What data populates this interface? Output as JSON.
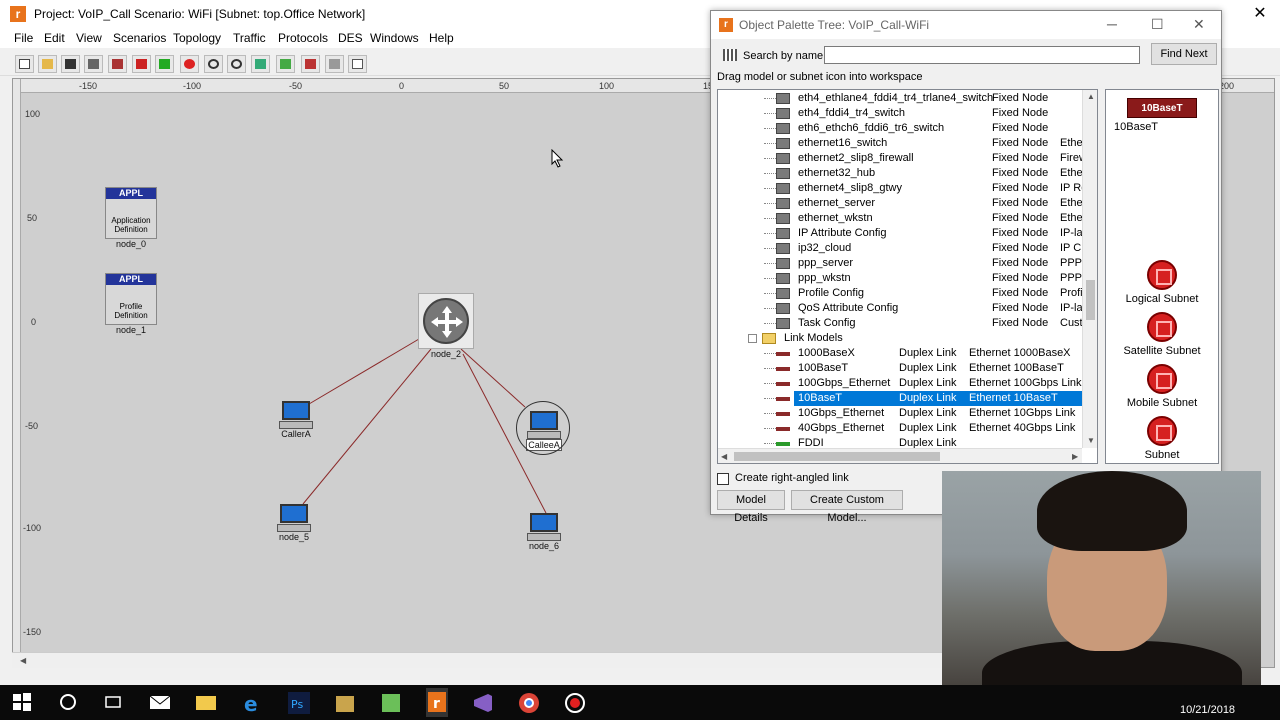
{
  "window": {
    "title": "Project: VoIP_Call Scenario: WiFi  [Subnet: top.Office Network]",
    "app_icon_letter": "r",
    "close_glyph": "✕"
  },
  "menu": [
    "File",
    "Edit",
    "View",
    "Scenarios",
    "Topology",
    "Traffic",
    "Protocols",
    "DES",
    "Windows",
    "Help"
  ],
  "toolbar_icons": [
    "new-icon",
    "open-icon",
    "save-icon",
    "print-icon",
    "node-config-icon",
    "failure-icon",
    "recover-icon",
    "annotation-icon",
    "zoom-in-icon",
    "zoom-out-icon",
    "ace-icon",
    "simulate-icon",
    "results-icon",
    "edit-attributes-icon",
    "graph-icon"
  ],
  "ruler": {
    "x_labels": [
      "-150",
      "-100",
      "-50",
      "0",
      "50",
      "100",
      "150",
      "200"
    ],
    "y_labels": [
      "100",
      "50",
      "0",
      "-50",
      "-100",
      "-150"
    ]
  },
  "nodes": {
    "node_0": {
      "label": "node_0",
      "badge": "APPL",
      "text": "Application Definition"
    },
    "node_1": {
      "label": "node_1",
      "badge": "APPL",
      "text": "Profile Definition"
    },
    "node_2": {
      "label": "node_2"
    },
    "caller_a": {
      "label": "CallerA"
    },
    "callee_a": {
      "label": "CalleeA"
    },
    "node_5": {
      "label": "node_5"
    },
    "node_6": {
      "label": "node_6"
    }
  },
  "link_color": "#8b2a2a",
  "palette": {
    "title": "Object Palette Tree: VoIP_Call-WiFi",
    "search_label": "Search by name:",
    "search_value": "",
    "find_next": "Find Next",
    "drag_hint": "Drag model or subnet icon into workspace",
    "rows": [
      {
        "name": "eth4_ethlane4_fddi4_tr4_trlane4_switch",
        "kind": "Fixed Node",
        "desc": ""
      },
      {
        "name": "eth4_fddi4_tr4_switch",
        "kind": "Fixed Node",
        "desc": ""
      },
      {
        "name": "eth6_ethch6_fddi6_tr6_switch",
        "kind": "Fixed Node",
        "desc": ""
      },
      {
        "name": "ethernet16_switch",
        "kind": "Fixed Node",
        "desc": "Ethe"
      },
      {
        "name": "ethernet2_slip8_firewall",
        "kind": "Fixed Node",
        "desc": "Firew"
      },
      {
        "name": "ethernet32_hub",
        "kind": "Fixed Node",
        "desc": "Ethe"
      },
      {
        "name": "ethernet4_slip8_gtwy",
        "kind": "Fixed Node",
        "desc": "IP Ro"
      },
      {
        "name": "ethernet_server",
        "kind": "Fixed Node",
        "desc": "Ethe"
      },
      {
        "name": "ethernet_wkstn",
        "kind": "Fixed Node",
        "desc": "Ethe"
      },
      {
        "name": "IP Attribute Config",
        "kind": "Fixed Node",
        "desc": "IP-lay"
      },
      {
        "name": "ip32_cloud",
        "kind": "Fixed Node",
        "desc": "IP Cl"
      },
      {
        "name": "ppp_server",
        "kind": "Fixed Node",
        "desc": "PPP"
      },
      {
        "name": "ppp_wkstn",
        "kind": "Fixed Node",
        "desc": "PPP"
      },
      {
        "name": "Profile Config",
        "kind": "Fixed Node",
        "desc": "Profil"
      },
      {
        "name": "QoS Attribute Config",
        "kind": "Fixed Node",
        "desc": "IP-lay"
      },
      {
        "name": "Task Config",
        "kind": "Fixed Node",
        "desc": "Custo"
      }
    ],
    "folder": "Link Models",
    "link_rows": [
      {
        "name": "1000BaseX",
        "kind": "Duplex Link",
        "desc": "Ethernet 1000BaseX"
      },
      {
        "name": "100BaseT",
        "kind": "Duplex Link",
        "desc": "Ethernet 100BaseT"
      },
      {
        "name": "100Gbps_Ethernet",
        "kind": "Duplex Link",
        "desc": "Ethernet 100Gbps Link"
      },
      {
        "name": "10BaseT",
        "kind": "Duplex Link",
        "desc": "Ethernet 10BaseT"
      },
      {
        "name": "10Gbps_Ethernet",
        "kind": "Duplex Link",
        "desc": "Ethernet 10Gbps Link"
      },
      {
        "name": "40Gbps_Ethernet",
        "kind": "Duplex Link",
        "desc": "Ethernet 40Gbps Link"
      },
      {
        "name": "FDDI",
        "kind": "Duplex Link",
        "desc": ""
      }
    ],
    "selected_link": "10BaseT",
    "right_items": [
      {
        "icon_text": "10BaseT",
        "label": "10BaseT"
      },
      {
        "label": "Logical Subnet"
      },
      {
        "label": "Satellite Subnet"
      },
      {
        "label": "Mobile Subnet"
      },
      {
        "label": "Subnet"
      }
    ],
    "checkbox_label": "Create right-angled link",
    "btn_model_details": "Model Details",
    "btn_create_custom": "Create Custom Model..."
  },
  "taskbar": {
    "icons": [
      "windows-start-icon",
      "cortana-icon",
      "task-view-icon",
      "mail-icon",
      "file-explorer-icon",
      "edge-icon",
      "photoshop-icon",
      "tool-icon",
      "notepad-icon",
      "riverbed-icon",
      "visual-studio-icon",
      "chrome-icon",
      "record-icon"
    ],
    "clock": "10/21/2018"
  }
}
